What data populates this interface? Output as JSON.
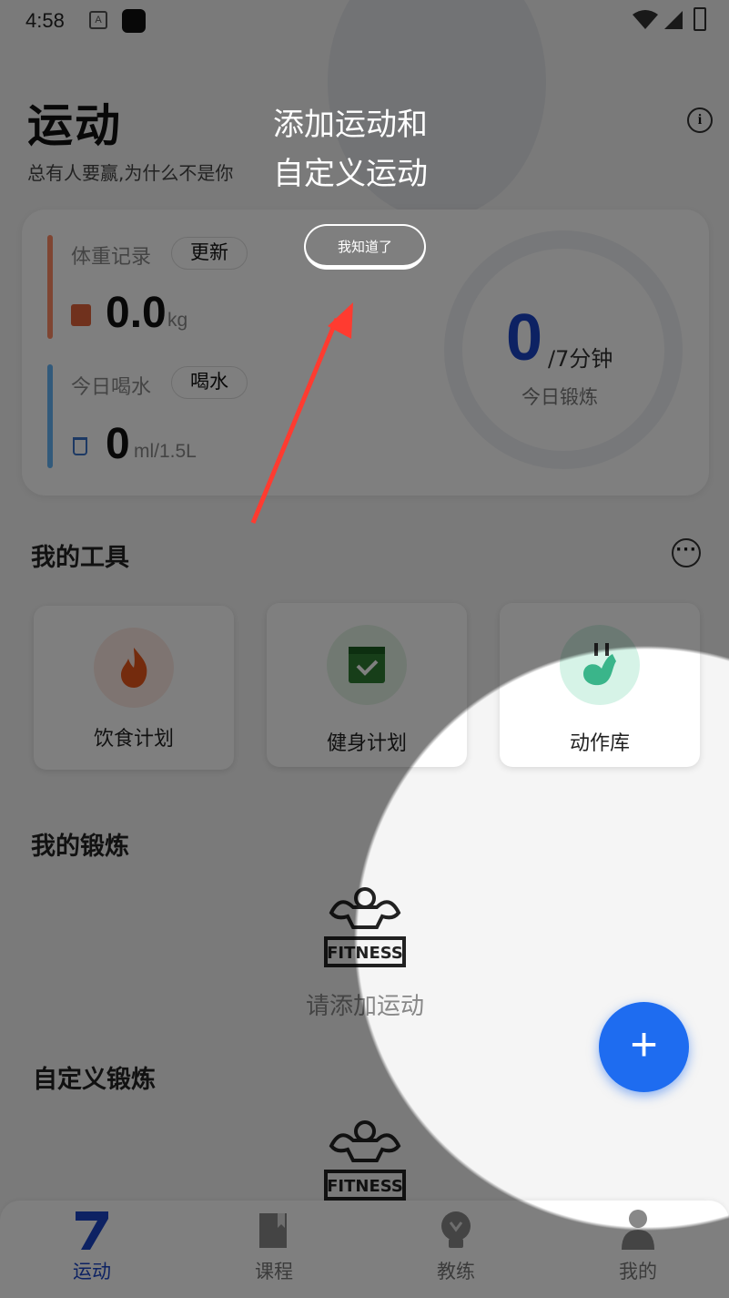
{
  "status": {
    "time": "4:58",
    "notif_icon": "A"
  },
  "header": {
    "title": "运动",
    "subtitle": "总有人要赢,为什么不是你",
    "info_icon": "i"
  },
  "weight": {
    "label": "体重记录",
    "button": "更新",
    "value": "0.0",
    "unit": "kg"
  },
  "water": {
    "label": "今日喝水",
    "button": "喝水",
    "value": "0",
    "unit": "ml/1.5L"
  },
  "exercise": {
    "value": "0",
    "unit": "/7分钟",
    "label": "今日锻炼"
  },
  "tools": {
    "title": "我的工具",
    "more_icon": "···",
    "items": [
      {
        "label": "饮食计划",
        "icon": "fire-icon",
        "color": "#e8561a"
      },
      {
        "label": "健身计划",
        "icon": "calendar-check-icon",
        "color": "#2e7d32"
      },
      {
        "label": "动作库",
        "icon": "arm-flex-icon",
        "color": "#3ab58a"
      }
    ]
  },
  "my_exercise": {
    "title": "我的锻炼",
    "empty_label": "请添加运动",
    "fitness_label": "FITNESS"
  },
  "custom_exercise": {
    "title": "自定义锻炼",
    "fitness_label": "FITNESS"
  },
  "fab": {
    "label": "+"
  },
  "guide": {
    "text_line1": "添加运动和",
    "text_line2": "自定义运动",
    "button": "我知道了"
  },
  "tabs": [
    {
      "label": "运动",
      "icon": "seven-icon",
      "active": true
    },
    {
      "label": "课程",
      "icon": "book-icon",
      "active": false
    },
    {
      "label": "教练",
      "icon": "bulb-icon",
      "active": false
    },
    {
      "label": "我的",
      "icon": "person-icon",
      "active": false
    }
  ],
  "colors": {
    "accent": "#1e6cf0",
    "ring_number": "#1a44c7",
    "weight_bar": "#ff8a65",
    "water_bar": "#64b5f6"
  }
}
